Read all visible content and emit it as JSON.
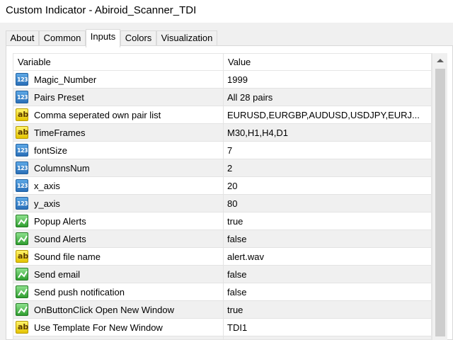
{
  "window": {
    "title": "Custom Indicator - Abiroid_Scanner_TDI"
  },
  "tabs": [
    {
      "label": "About"
    },
    {
      "label": "Common"
    },
    {
      "label": "Inputs"
    },
    {
      "label": "Colors"
    },
    {
      "label": "Visualization"
    }
  ],
  "active_tab": "Inputs",
  "grid": {
    "col_variable": "Variable",
    "col_value": "Value",
    "rows": [
      {
        "type": "int-icon",
        "name": "Magic_Number",
        "value": "1999"
      },
      {
        "type": "int-icon",
        "name": "Pairs Preset",
        "value": "All 28 pairs"
      },
      {
        "type": "string-icon",
        "name": "Comma seperated own pair list",
        "value": "EURUSD,EURGBP,AUDUSD,USDJPY,EURJ..."
      },
      {
        "type": "string-icon",
        "name": "TimeFrames",
        "value": "M30,H1,H4,D1"
      },
      {
        "type": "int-icon",
        "name": "fontSize",
        "value": "7"
      },
      {
        "type": "int-icon",
        "name": "ColumnsNum",
        "value": "2"
      },
      {
        "type": "int-icon",
        "name": "x_axis",
        "value": "20"
      },
      {
        "type": "int-icon",
        "name": "y_axis",
        "value": "80"
      },
      {
        "type": "bool-icon",
        "name": "Popup Alerts",
        "value": "true"
      },
      {
        "type": "bool-icon",
        "name": "Sound Alerts",
        "value": "false"
      },
      {
        "type": "string-icon",
        "name": "Sound file name",
        "value": "alert.wav"
      },
      {
        "type": "bool-icon",
        "name": "Send email",
        "value": "false"
      },
      {
        "type": "bool-icon",
        "name": "Send push notification",
        "value": "false"
      },
      {
        "type": "bool-icon",
        "name": "OnButtonClick Open New Window",
        "value": "true"
      },
      {
        "type": "string-icon",
        "name": "Use Template For New Window",
        "value": "TDI1"
      },
      {
        "type": "",
        "name": "",
        "value": ""
      }
    ]
  }
}
